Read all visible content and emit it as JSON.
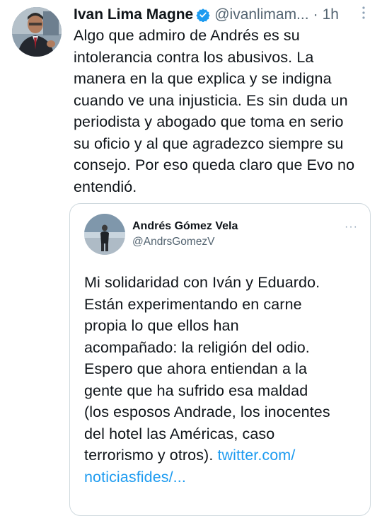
{
  "tweet": {
    "author_name": "Ivan Lima Magne",
    "handle": "@ivanlimam...",
    "separator": "·",
    "time": "1h",
    "verified": true,
    "avatar_icon": "user-avatar-photo",
    "text": "Algo que admiro de Andrés es su\nintolerancia contra los abusivos. La\nmanera en la que explica y se indigna\ncuando ve una injusticia. Es sin duda un\nperiodista y abogado que toma en serio\nsu oficio y al que agradezco siempre su\nconsejo.  Por eso queda claro que Evo no\nentendió."
  },
  "quoted_tweet": {
    "author_name": "Andrés Gómez Vela",
    "handle": "@AndrsGomezV",
    "more_label": "···",
    "avatar_icon": "user-avatar-photo",
    "text": "Mi solidaridad con Iván y Eduardo.\nEstán experimentando en carne\npropia lo que ellos han\nacompañado: la religión del odio.\nEspero que ahora entiendan a la\ngente que ha sufrido esa maldad\n(los esposos Andrade, los inocentes\ndel hotel las Américas, caso\nterrorismo y otros). ",
    "link_part1": "twitter.com/",
    "link_part2": "noticiasfides/..."
  },
  "colors": {
    "text": "#0f1419",
    "secondary": "#536471",
    "link": "#1d9bf0",
    "verified": "#1d9bf0",
    "border": "#cfd9de"
  }
}
